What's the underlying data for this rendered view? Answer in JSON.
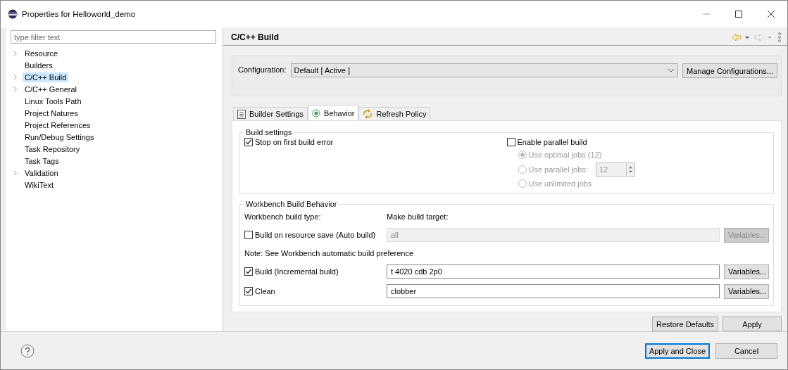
{
  "window": {
    "title": "Properties for Helloworld_demo"
  },
  "filter": {
    "placeholder": "type filter text"
  },
  "tree": [
    {
      "label": "Resource",
      "expandable": true,
      "selected": false
    },
    {
      "label": "Builders",
      "expandable": false,
      "selected": false
    },
    {
      "label": "C/C++ Build",
      "expandable": true,
      "selected": true
    },
    {
      "label": "C/C++ General",
      "expandable": true,
      "selected": false
    },
    {
      "label": "Linux Tools Path",
      "expandable": false,
      "selected": false
    },
    {
      "label": "Project Natures",
      "expandable": false,
      "selected": false
    },
    {
      "label": "Project References",
      "expandable": false,
      "selected": false
    },
    {
      "label": "Run/Debug Settings",
      "expandable": false,
      "selected": false
    },
    {
      "label": "Task Repository",
      "expandable": false,
      "selected": false
    },
    {
      "label": "Task Tags",
      "expandable": false,
      "selected": false
    },
    {
      "label": "Validation",
      "expandable": true,
      "selected": false
    },
    {
      "label": "WikiText",
      "expandable": false,
      "selected": false
    }
  ],
  "page_title": "C/C++ Build",
  "configuration": {
    "label": "Configuration:",
    "value": "Default  [ Active ]",
    "button": "Manage Configurations..."
  },
  "tabs": [
    {
      "label": "Builder Settings",
      "kind": "list",
      "selected": false
    },
    {
      "label": "Behavior",
      "kind": "radio",
      "selected": true
    },
    {
      "label": "Refresh Policy",
      "kind": "refresh",
      "selected": false
    }
  ],
  "build_settings": {
    "title": "Build settings",
    "stop_on_error": {
      "label": "Stop on first build error",
      "checked": true
    },
    "parallel": {
      "label": "Enable parallel build",
      "checked": false
    },
    "jobs": [
      {
        "label": "Use optimal jobs (12)",
        "selected": true,
        "disabled": true
      },
      {
        "label": "Use parallel jobs:",
        "selected": false,
        "disabled": true
      },
      {
        "label": "Use unlimited jobs",
        "selected": false,
        "disabled": true
      }
    ],
    "jobs_value": "12"
  },
  "workbench": {
    "title": "Workbench Build Behavior",
    "type_heading": "Workbench build type:",
    "target_heading": "Make build target:",
    "rows": [
      {
        "kind": "option",
        "label": "Build on resource save (Auto build)",
        "checked": false,
        "value": "all",
        "button": "Variables...",
        "disabled": true
      },
      {
        "kind": "note",
        "label": "Note: See Workbench automatic build preference"
      },
      {
        "kind": "option",
        "label": "Build (Incremental build)",
        "checked": true,
        "value": "t 4020 cdb 2p0",
        "button": "Variables...",
        "disabled": false
      },
      {
        "kind": "option",
        "label": "Clean",
        "checked": true,
        "value": "clobber",
        "button": "Variables...",
        "disabled": false
      }
    ]
  },
  "page_buttons": [
    "Restore Defaults",
    "Apply"
  ],
  "dialog_buttons": [
    {
      "label": "Apply and Close",
      "default": true
    },
    {
      "label": "Cancel",
      "default": false
    }
  ]
}
